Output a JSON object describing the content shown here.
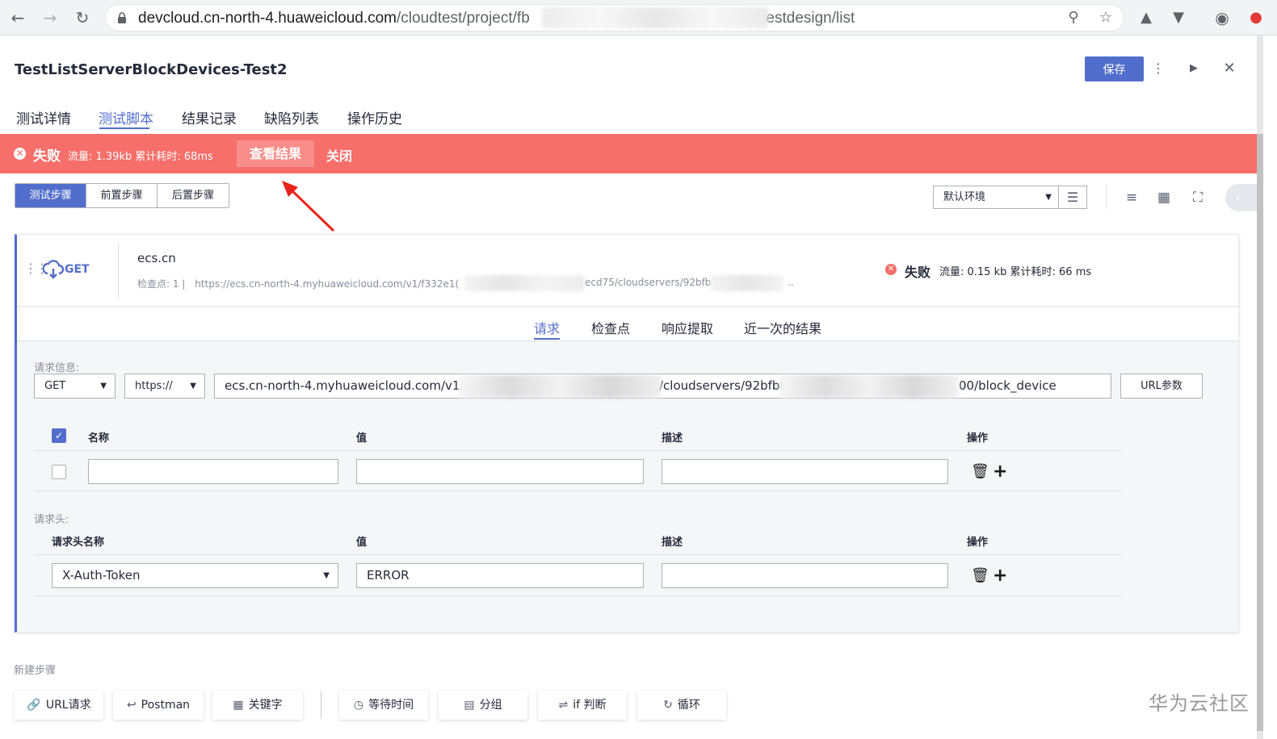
{
  "browser": {
    "url_host": "devcloud.cn-north-4.huaweicloud.com",
    "url_path_a": "/cloudtest/project/fb",
    "url_path_b": "c8/testdesign/list"
  },
  "header": {
    "title": "TestListServerBlockDevices-Test2",
    "save_label": "保存"
  },
  "tabs": [
    {
      "label": "测试详情"
    },
    {
      "label": "测试脚本"
    },
    {
      "label": "结果记录"
    },
    {
      "label": "缺陷列表"
    },
    {
      "label": "操作历史"
    }
  ],
  "banner": {
    "status": "失败",
    "meta": "流量: 1.39kb   累计耗时: 68ms",
    "view_label": "查看结果",
    "close_label": "关闭",
    "color": "#f66f6a"
  },
  "step_tabs": [
    {
      "label": "测试步骤"
    },
    {
      "label": "前置步骤"
    },
    {
      "label": "后置步骤"
    }
  ],
  "env": {
    "selected": "默认环境"
  },
  "step": {
    "method": "GET",
    "name": "ecs.cn",
    "checkpoints": "检查点:  1   |",
    "url_a": "https://ecs.cn-north-4.myhuaweicloud.com/v1/f332e1(",
    "url_b": "ecd75/cloudservers/92bfb",
    "url_c": "..",
    "status": "失败",
    "meta": "流量:  0.15 kb    累计耗时:  66 ms"
  },
  "inner_tabs": [
    {
      "label": "请求"
    },
    {
      "label": "检查点"
    },
    {
      "label": "响应提取"
    },
    {
      "label": "近一次的结果"
    }
  ],
  "request": {
    "info_label": "请求信息:",
    "method": "GET",
    "protocol": "https://",
    "url_a": "ecs.cn-north-4.myhuaweicloud.com/v1/f33",
    "url_b": "/cloudservers/92bfb8",
    "url_c": "00/block_device",
    "url_param_label": "URL参数",
    "params_columns": {
      "name": "名称",
      "value": "值",
      "desc": "描述",
      "op": "操作"
    },
    "headers_label": "请求头:",
    "headers_columns": {
      "name": "请求头名称",
      "value": "值",
      "desc": "描述",
      "op": "操作"
    },
    "header_row": {
      "name": "X-Auth-Token",
      "value": "ERROR"
    }
  },
  "new_step": {
    "label": "新建步骤",
    "buttons": [
      {
        "label": "URL请求",
        "icon": "link-icon"
      },
      {
        "label": "Postman",
        "icon": "import-icon"
      },
      {
        "label": "关键字",
        "icon": "keyword-icon"
      },
      {
        "label": "等待时间",
        "icon": "clock-icon"
      },
      {
        "label": "分组",
        "icon": "group-icon"
      },
      {
        "label": "if 判断",
        "icon": "shuffle-icon"
      },
      {
        "label": "循环",
        "icon": "loop-icon"
      }
    ]
  },
  "watermark": "华为云社区",
  "colors": {
    "accent": "#526ecc",
    "error": "#f66f6a"
  }
}
